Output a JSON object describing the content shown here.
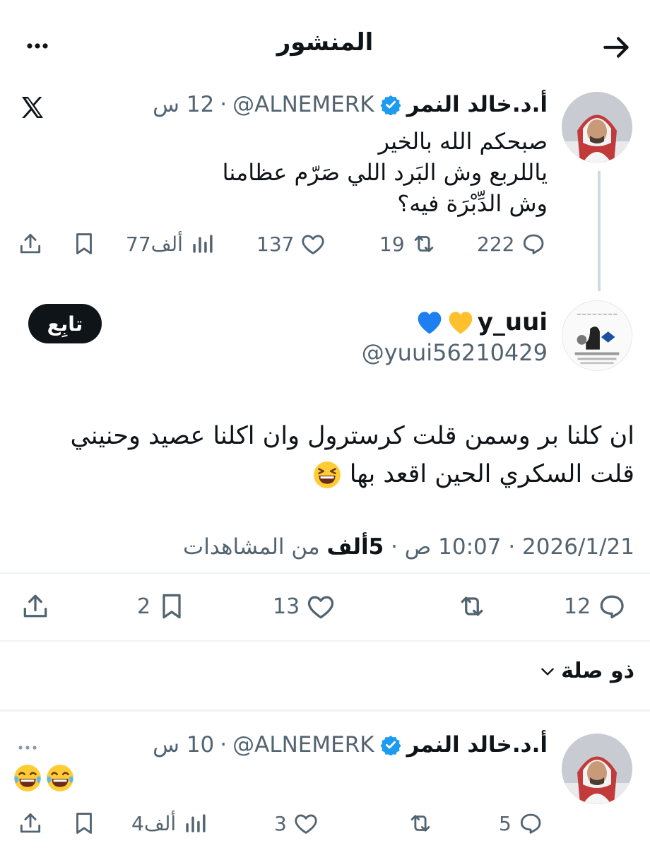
{
  "header": {
    "title": "المنشور"
  },
  "icons": {
    "back": "arrow-right-icon",
    "more": "more-horizontal-icon",
    "x_logo": "x-logo-icon",
    "verified": "verified-badge-icon"
  },
  "colors": {
    "verified": "#1d9bf0",
    "text": "#0f1419",
    "secondary": "#536471",
    "divider": "#eff3f4"
  },
  "parent_tweet": {
    "author_name": "أ.د.خالد النمر",
    "handle": "@ALNEMERK",
    "separator": "·",
    "time": "12 س",
    "text": "صبحكم الله بالخير\nياللربع وش البَرد اللي صَرّم عظامنا\nوش الدِّبْرَة فيه؟",
    "replies": "222",
    "reposts": "19",
    "likes": "137",
    "views": "77ألف"
  },
  "main_tweet": {
    "author_name": "y_uui",
    "handle": "@yuui56210429",
    "follow_label": "تابِع",
    "text": "ان كلنا بر وسمن قلت كرسترول وان اكلنا عصيد وحنيني\nقلت السكري الحين اقعد بها",
    "date": "2026/1/21",
    "time": "10:07 ص",
    "views_count": "5ألف",
    "views_label": "من المشاهدات",
    "replies": "12",
    "reposts": "",
    "likes": "13",
    "bookmarks": "2"
  },
  "related_label": "ذو صلة",
  "reply_tweet": {
    "author_name": "أ.د.خالد النمر",
    "handle": "@ALNEMERK",
    "separator": "·",
    "time": "10 س",
    "replies": "5",
    "likes": "3",
    "views": "4ألف"
  }
}
